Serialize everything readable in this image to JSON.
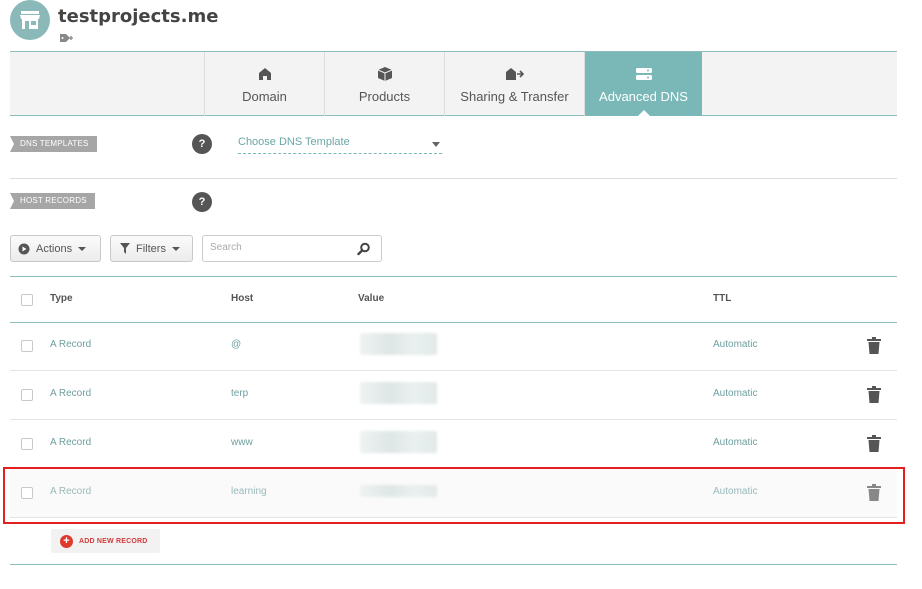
{
  "header": {
    "domain": "testprojects.me"
  },
  "tabs": [
    {
      "label": "Domain",
      "icon": "home-icon",
      "active": false
    },
    {
      "label": "Products",
      "icon": "box-icon",
      "active": false
    },
    {
      "label": "Sharing & Transfer",
      "icon": "house-arrow-icon",
      "active": false
    },
    {
      "label": "Advanced DNS",
      "icon": "server-icon",
      "active": true
    }
  ],
  "dns_templates": {
    "label": "DNS TEMPLATES",
    "help": "?",
    "select_value": "Choose DNS Template"
  },
  "host_records": {
    "label": "HOST RECORDS",
    "help": "?"
  },
  "toolbar": {
    "actions_label": "Actions",
    "filters_label": "Filters",
    "search_placeholder": "Search"
  },
  "table": {
    "columns": {
      "type": "Type",
      "host": "Host",
      "value": "Value",
      "ttl": "TTL"
    },
    "rows": [
      {
        "type": "A Record",
        "host": "@",
        "ttl": "Automatic"
      },
      {
        "type": "A Record",
        "host": "terp",
        "ttl": "Automatic"
      },
      {
        "type": "A Record",
        "host": "www",
        "ttl": "Automatic"
      },
      {
        "type": "A Record",
        "host": "learning",
        "ttl": "Automatic"
      }
    ]
  },
  "add_record_label": "ADD NEW RECORD",
  "colors": {
    "accent": "#7ab8b8",
    "highlight_outline": "#e41f1f",
    "add_button": "#e03a2f"
  }
}
